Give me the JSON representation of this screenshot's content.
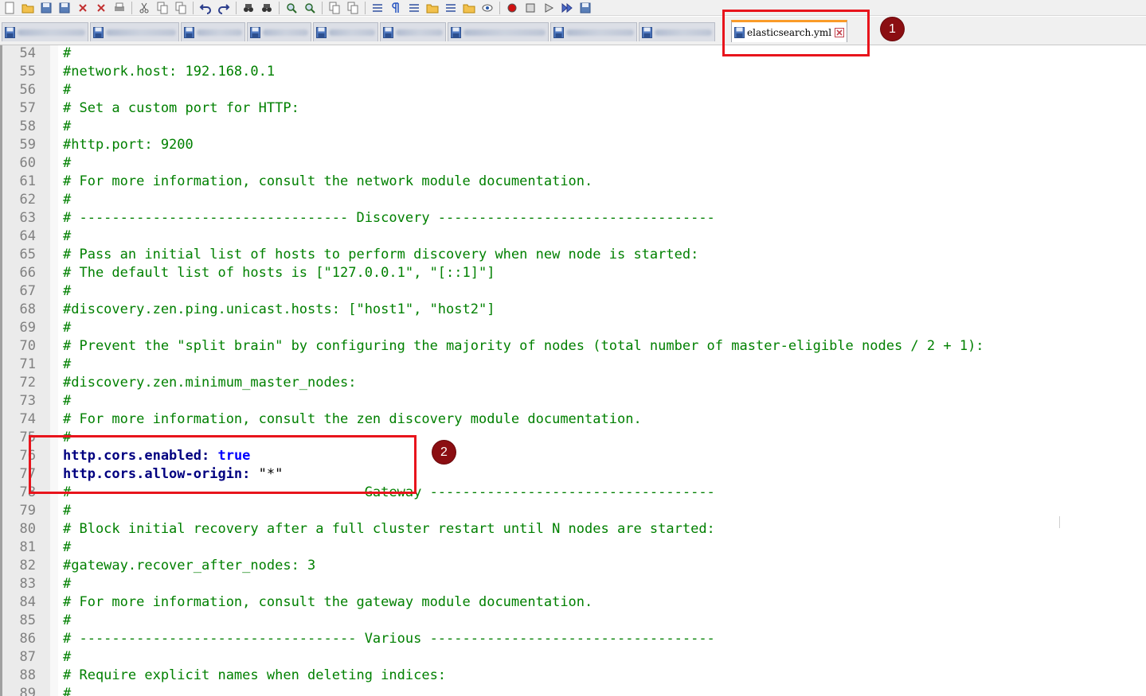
{
  "toolbar": {
    "icons": [
      "new-file-icon",
      "open-file-icon",
      "save-icon",
      "save-all-icon",
      "close-icon",
      "close-all-icon",
      "print-icon",
      "cut-icon",
      "copy-icon",
      "paste-icon",
      "undo-icon",
      "redo-icon",
      "find-icon",
      "replace-icon",
      "zoom-in-icon",
      "zoom-out-icon",
      "sync-vertical-icon",
      "sync-horizontal-icon",
      "word-wrap-icon",
      "show-all-chars-icon",
      "indent-guide-icon",
      "doc-map-icon",
      "function-list-icon",
      "folder-as-workspace-icon",
      "monitor-icon",
      "record-macro-icon",
      "stop-macro-icon",
      "play-macro-icon",
      "run-macro-multiple-icon",
      "save-macro-icon"
    ]
  },
  "tabs": {
    "blurred_count": 9,
    "active_label": "elasticsearch.yml"
  },
  "annotations": {
    "badge1": "1",
    "badge2": "2"
  },
  "editor": {
    "lines": [
      {
        "n": "54",
        "t": "#",
        "k": "comment"
      },
      {
        "n": "55",
        "t": "#network.host: 192.168.0.1",
        "k": "comment"
      },
      {
        "n": "56",
        "t": "#",
        "k": "comment"
      },
      {
        "n": "57",
        "t": "# Set a custom port for HTTP:",
        "k": "comment"
      },
      {
        "n": "58",
        "t": "#",
        "k": "comment"
      },
      {
        "n": "59",
        "t": "#http.port: 9200",
        "k": "comment"
      },
      {
        "n": "60",
        "t": "#",
        "k": "comment"
      },
      {
        "n": "61",
        "t": "# For more information, consult the network module documentation.",
        "k": "comment"
      },
      {
        "n": "62",
        "t": "#",
        "k": "comment"
      },
      {
        "n": "63",
        "t": "# --------------------------------- Discovery ----------------------------------",
        "k": "comment"
      },
      {
        "n": "64",
        "t": "#",
        "k": "comment"
      },
      {
        "n": "65",
        "t": "# Pass an initial list of hosts to perform discovery when new node is started:",
        "k": "comment"
      },
      {
        "n": "66",
        "t": "# The default list of hosts is [\"127.0.0.1\", \"[::1]\"]",
        "k": "comment"
      },
      {
        "n": "67",
        "t": "#",
        "k": "comment"
      },
      {
        "n": "68",
        "t": "#discovery.zen.ping.unicast.hosts: [\"host1\", \"host2\"]",
        "k": "comment"
      },
      {
        "n": "69",
        "t": "#",
        "k": "comment"
      },
      {
        "n": "70",
        "t": "# Prevent the \"split brain\" by configuring the majority of nodes (total number of master-eligible nodes / 2 + 1):",
        "k": "comment"
      },
      {
        "n": "71",
        "t": "#",
        "k": "comment"
      },
      {
        "n": "72",
        "t": "#discovery.zen.minimum_master_nodes:",
        "k": "comment"
      },
      {
        "n": "73",
        "t": "#",
        "k": "comment"
      },
      {
        "n": "74",
        "t": "# For more information, consult the zen discovery module documentation.",
        "k": "comment"
      },
      {
        "n": "75",
        "t": "#",
        "k": "comment"
      },
      {
        "n": "76",
        "t": "http.cors.enabled: ",
        "k": "key",
        "v": "true",
        "vk": "bool"
      },
      {
        "n": "77",
        "t": "http.cors.allow-origin: ",
        "k": "key",
        "v": "\"*\"",
        "vk": "str"
      },
      {
        "n": "78",
        "t": "# ---------------------------------- Gateway -----------------------------------",
        "k": "comment"
      },
      {
        "n": "79",
        "t": "#",
        "k": "comment"
      },
      {
        "n": "80",
        "t": "# Block initial recovery after a full cluster restart until N nodes are started:",
        "k": "comment"
      },
      {
        "n": "81",
        "t": "#",
        "k": "comment"
      },
      {
        "n": "82",
        "t": "#gateway.recover_after_nodes: 3",
        "k": "comment"
      },
      {
        "n": "83",
        "t": "#",
        "k": "comment"
      },
      {
        "n": "84",
        "t": "# For more information, consult the gateway module documentation.",
        "k": "comment"
      },
      {
        "n": "85",
        "t": "#",
        "k": "comment"
      },
      {
        "n": "86",
        "t": "# ---------------------------------- Various -----------------------------------",
        "k": "comment"
      },
      {
        "n": "87",
        "t": "#",
        "k": "comment"
      },
      {
        "n": "88",
        "t": "# Require explicit names when deleting indices:",
        "k": "comment"
      },
      {
        "n": "89",
        "t": "#",
        "k": "comment"
      }
    ]
  }
}
